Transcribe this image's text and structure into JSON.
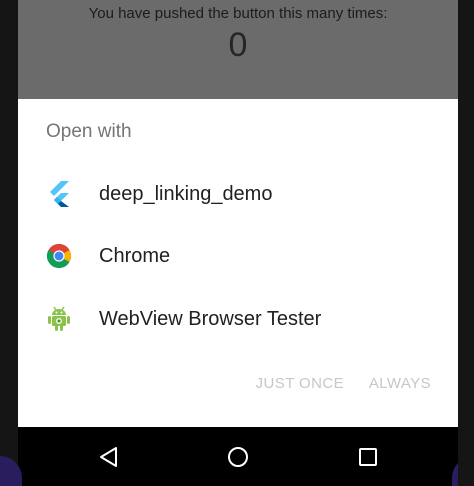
{
  "app": {
    "counter_caption": "You have pushed the button this many times:",
    "counter_value": "0"
  },
  "chooser": {
    "title": "Open with",
    "apps": [
      {
        "label": "deep_linking_demo",
        "icon": "flutter-icon"
      },
      {
        "label": "Chrome",
        "icon": "chrome-icon"
      },
      {
        "label": "WebView Browser Tester",
        "icon": "android-icon"
      }
    ],
    "buttons": {
      "just_once": "JUST ONCE",
      "always": "ALWAYS"
    },
    "button_color": "#c7c7c7"
  },
  "navbar": {
    "back_icon": "back-triangle-icon",
    "home_icon": "home-circle-icon",
    "recents_icon": "recents-square-icon"
  }
}
